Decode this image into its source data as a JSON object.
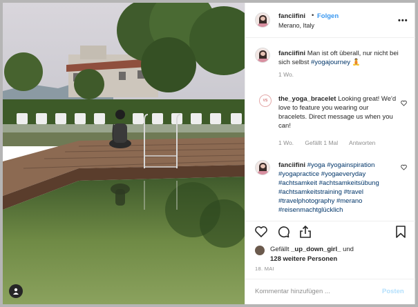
{
  "post": {
    "username": "fanciifini",
    "separator": "•",
    "follow_label": "Folgen",
    "location": "Merano, Italy",
    "more_label": "•••"
  },
  "comments": [
    {
      "username": "fanciifini",
      "text": "Man ist oft überall, nur nicht bei sich selbst",
      "tag": "#yogajourney",
      "emoji": "🧘"
    },
    {
      "username": "the_yoga_bracelet",
      "logo": "VS",
      "text": "Looking great! We'd love to feature you wearing our bracelets. Direct message us when you can!",
      "time": "1 Wo.",
      "likes": "Gefällt 1 Mal",
      "reply": "Antworten"
    },
    {
      "username": "fanciifini",
      "tags": "#yoga #yogainspiration #yogapractice #yogaeveryday #achtsamkeit #achtsamkeitsübung #achtsamkeitstraining #travel #travelphotography #merano #reisenmachtglücklich"
    }
  ],
  "caption_time": "1 Wo.",
  "likes": {
    "prefix": "Gefällt",
    "user": "_up_down_girl_",
    "and": "und",
    "others": "128 weitere Personen"
  },
  "date": "18. MAI",
  "add_comment": {
    "placeholder": "Kommentar hinzufügen ...",
    "post_label": "Posten"
  },
  "icons": {
    "like": "heart-icon",
    "comment": "comment-icon",
    "share": "share-icon",
    "save": "bookmark-icon",
    "user_tag": "user-tag-icon"
  },
  "colors": {
    "link": "#3897f0",
    "hashtag": "#003569",
    "muted": "#8e8e8e",
    "post_disabled": "#b2dffc"
  }
}
